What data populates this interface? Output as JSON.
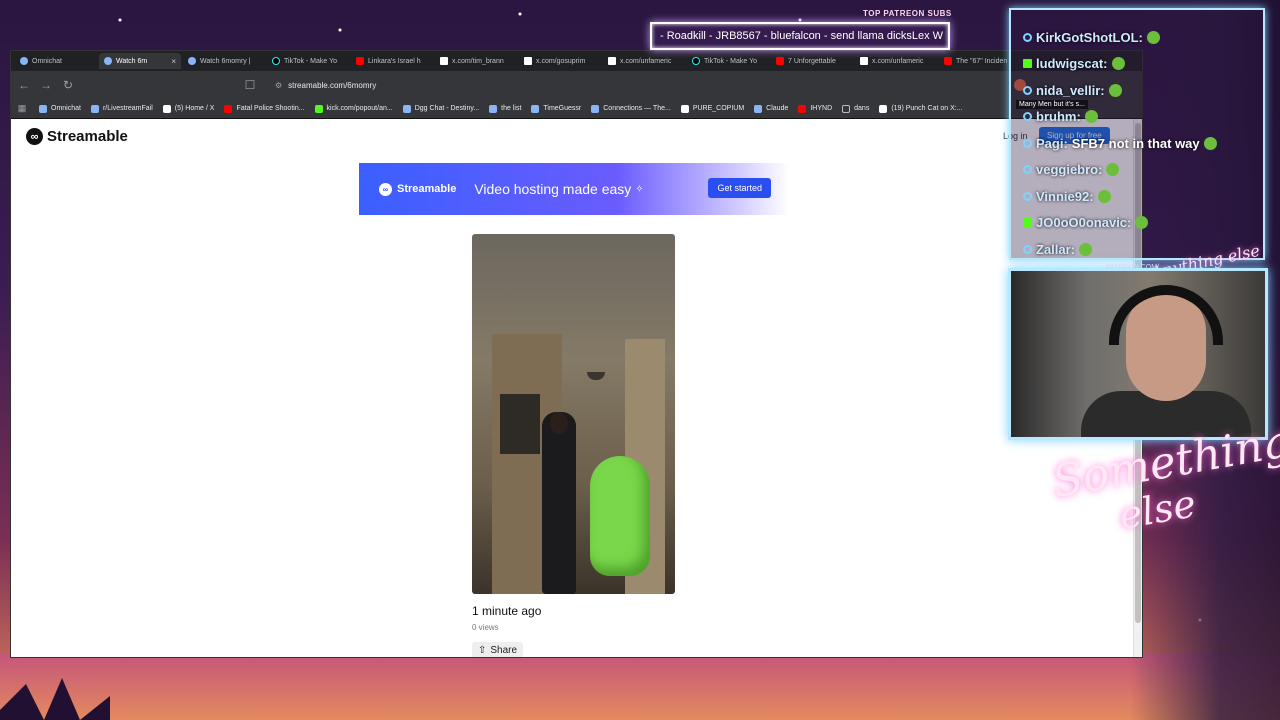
{
  "browser": {
    "tabs": [
      {
        "label": "Omnichat",
        "icon": "omnichat-icon",
        "active": false
      },
      {
        "label": "Watch 6m",
        "icon": "streamable-icon",
        "active": true
      },
      {
        "label": "Watch 6momry |",
        "icon": "streamable-icon",
        "active": false
      },
      {
        "label": "TikTok - Make Yo",
        "icon": "tiktok-icon",
        "active": false
      },
      {
        "label": "Linkara's Israel h",
        "icon": "youtube-icon",
        "active": false
      },
      {
        "label": "x.com/tim_brann",
        "icon": "x-icon",
        "active": false
      },
      {
        "label": "x.com/gosuprim",
        "icon": "x-icon",
        "active": false
      },
      {
        "label": "x.com/unfameric",
        "icon": "x-icon",
        "active": false
      },
      {
        "label": "TikTok - Make Yo",
        "icon": "tiktok-icon",
        "active": false
      },
      {
        "label": "7 Unforgettable",
        "icon": "youtube-icon",
        "active": false
      },
      {
        "label": "x.com/unfameric",
        "icon": "x-icon",
        "active": false
      },
      {
        "label": "The \"67\" Inciden",
        "icon": "youtube-icon",
        "active": false
      }
    ],
    "url": "streamable.com/6momry",
    "bookmarks": [
      {
        "label": "Omnichat",
        "icon": "omnichat-icon"
      },
      {
        "label": "r/LivestreamFail",
        "icon": "reddit-icon"
      },
      {
        "label": "(5) Home / X",
        "icon": "x-icon"
      },
      {
        "label": "Fatal Police Shootin...",
        "icon": "youtube-icon"
      },
      {
        "label": "kick.com/popout/an...",
        "icon": "kick-icon"
      },
      {
        "label": "Dgg Chat - Destiny...",
        "icon": "dgg-icon"
      },
      {
        "label": "the list",
        "icon": "pinterest-icon"
      },
      {
        "label": "TimeGuessr",
        "icon": "globe-icon"
      },
      {
        "label": "Connections — The...",
        "icon": "connections-icon"
      },
      {
        "label": "PURE_COPIUM",
        "icon": "x-icon"
      },
      {
        "label": "Claude",
        "icon": "claude-icon"
      },
      {
        "label": "IHYND",
        "icon": "youtube-icon"
      },
      {
        "label": "dans",
        "icon": "folder-icon"
      },
      {
        "label": "(19) Punch Cat on X:...",
        "icon": "x-icon"
      }
    ]
  },
  "page": {
    "logo_text": "Streamable",
    "login": "Log in",
    "signup": "Sign up for free",
    "banner": {
      "brand": "Streamable",
      "tagline": "Video hosting made easy",
      "cta": "Get started"
    },
    "video": {
      "uploaded": "1 minute ago",
      "views": "0 views",
      "share": "Share"
    }
  },
  "overlay": {
    "patreon_label": "TOP PATREON SUBS",
    "ticker": "- Roadkill - JRB8567 - bluefalcon - send llama dicksLex W",
    "chat": [
      {
        "badge": "circle",
        "user": "KirkGotShotLOL:",
        "text": ""
      },
      {
        "badge": "kick",
        "user": "ludwigscat:",
        "text": ""
      },
      {
        "badge": "circle",
        "user": "nida_vellir:",
        "text": ""
      },
      {
        "badge": "circle",
        "user": "bruhm:",
        "text": ""
      },
      {
        "badge": "circle",
        "user": "Pagi:",
        "text": "SFB7 not in that way"
      },
      {
        "badge": "circle",
        "user": "veggiebro:",
        "text": ""
      },
      {
        "badge": "circle",
        "user": "Vinnie92:",
        "text": ""
      },
      {
        "badge": "kick",
        "user": "JO0oO0onavic:",
        "text": ""
      },
      {
        "badge": "circle",
        "user": "Zallar:",
        "text": ""
      }
    ],
    "chat_popup": "Many Men but it's s...",
    "patreon_url": "PATREON.COM/",
    "brand_small": "Anything else",
    "brand_line1": "Something",
    "brand_line2": "else"
  },
  "colors": {
    "accent": "#3b5fff",
    "chat_border": "#b8e8ff",
    "brand_glow": "#ff6ad5"
  }
}
